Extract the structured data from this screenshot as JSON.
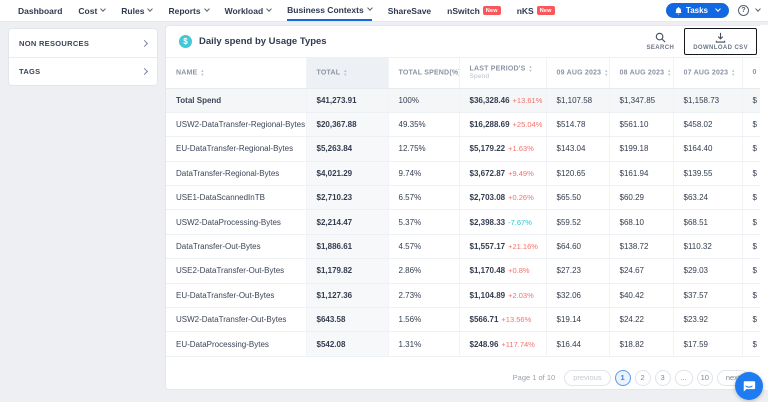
{
  "nav": {
    "items": [
      {
        "label": "Dashboard",
        "caret": false,
        "active": false
      },
      {
        "label": "Cost",
        "caret": true,
        "active": false
      },
      {
        "label": "Rules",
        "caret": true,
        "active": false
      },
      {
        "label": "Reports",
        "caret": true,
        "active": false
      },
      {
        "label": "Workload",
        "caret": true,
        "active": false
      },
      {
        "label": "Business Contexts",
        "caret": true,
        "active": true
      },
      {
        "label": "ShareSave",
        "caret": false,
        "active": false
      },
      {
        "label": "nSwitch",
        "caret": false,
        "active": false,
        "badge": "New"
      },
      {
        "label": "nKS",
        "caret": false,
        "active": false,
        "badge": "New"
      }
    ],
    "tasks_label": "Tasks"
  },
  "sidebar": {
    "items": [
      {
        "label": "NON RESOURCES"
      },
      {
        "label": "TAGS"
      }
    ]
  },
  "panel": {
    "title": "Daily spend by Usage Types",
    "toolbar": {
      "search_label": "SEARCH",
      "download_label": "DOWNLOAD CSV"
    }
  },
  "table": {
    "columns": [
      {
        "label": "NAME",
        "sortable": true,
        "highlighted": false
      },
      {
        "label": "TOTAL",
        "sortable": true,
        "highlighted": true
      },
      {
        "label": "TOTAL SPEND(%)",
        "sortable": true,
        "highlighted": false
      },
      {
        "label": "LAST PERIOD'S",
        "sub": "Spend",
        "sortable": true,
        "highlighted": false
      },
      {
        "label": "09 AUG 2023",
        "sortable": true,
        "highlighted": false
      },
      {
        "label": "08 AUG 2023",
        "sortable": true,
        "highlighted": false
      },
      {
        "label": "07 AUG 2023",
        "sortable": true,
        "highlighted": false
      },
      {
        "label": "0",
        "sortable": false,
        "highlighted": false,
        "clipped": true
      }
    ],
    "rows": [
      {
        "name": "Total Spend",
        "total": "$41,273.91",
        "pct": "100%",
        "last": {
          "value": "$36,328.46",
          "change": "+13.61%",
          "dir": "up"
        },
        "days": [
          "$1,107.58",
          "$1,347.85",
          "$1,158.73"
        ],
        "cut": "$",
        "emphasis": true
      },
      {
        "name": "USW2-DataTransfer-Regional-Bytes",
        "total": "$20,367.88",
        "pct": "49.35%",
        "last": {
          "value": "$16,288.69",
          "change": "+25.04%",
          "dir": "up"
        },
        "days": [
          "$514.78",
          "$561.10",
          "$458.02"
        ],
        "cut": "$",
        "emphasis": false
      },
      {
        "name": "EU-DataTransfer-Regional-Bytes",
        "total": "$5,263.84",
        "pct": "12.75%",
        "last": {
          "value": "$5,179.22",
          "change": "+1.63%",
          "dir": "up"
        },
        "days": [
          "$143.04",
          "$199.18",
          "$164.40"
        ],
        "cut": "$",
        "emphasis": false
      },
      {
        "name": "DataTransfer-Regional-Bytes",
        "total": "$4,021.29",
        "pct": "9.74%",
        "last": {
          "value": "$3,672.87",
          "change": "+9.49%",
          "dir": "up"
        },
        "days": [
          "$120.65",
          "$161.94",
          "$139.55"
        ],
        "cut": "$",
        "emphasis": false
      },
      {
        "name": "USE1-DataScannedInTB",
        "total": "$2,710.23",
        "pct": "6.57%",
        "last": {
          "value": "$2,703.08",
          "change": "+0.26%",
          "dir": "up"
        },
        "days": [
          "$65.50",
          "$60.29",
          "$63.24"
        ],
        "cut": "$",
        "emphasis": false
      },
      {
        "name": "USW2-DataProcessing-Bytes",
        "total": "$2,214.47",
        "pct": "5.37%",
        "last": {
          "value": "$2,398.33",
          "change": "-7.67%",
          "dir": "down"
        },
        "days": [
          "$59.52",
          "$68.10",
          "$68.51"
        ],
        "cut": "$",
        "emphasis": false
      },
      {
        "name": "DataTransfer-Out-Bytes",
        "total": "$1,886.61",
        "pct": "4.57%",
        "last": {
          "value": "$1,557.17",
          "change": "+21.16%",
          "dir": "up"
        },
        "days": [
          "$64.60",
          "$138.72",
          "$110.32"
        ],
        "cut": "$",
        "emphasis": false
      },
      {
        "name": "USE2-DataTransfer-Out-Bytes",
        "total": "$1,179.82",
        "pct": "2.86%",
        "last": {
          "value": "$1,170.48",
          "change": "+0.8%",
          "dir": "up"
        },
        "days": [
          "$27.23",
          "$24.67",
          "$29.03"
        ],
        "cut": "$",
        "emphasis": false
      },
      {
        "name": "EU-DataTransfer-Out-Bytes",
        "total": "$1,127.36",
        "pct": "2.73%",
        "last": {
          "value": "$1,104.89",
          "change": "+2.03%",
          "dir": "up"
        },
        "days": [
          "$32.06",
          "$40.42",
          "$37.57"
        ],
        "cut": "$",
        "emphasis": false
      },
      {
        "name": "USW2-DataTransfer-Out-Bytes",
        "total": "$643.58",
        "pct": "1.56%",
        "last": {
          "value": "$566.71",
          "change": "+13.56%",
          "dir": "up"
        },
        "days": [
          "$19.14",
          "$24.22",
          "$23.92"
        ],
        "cut": "$",
        "emphasis": false
      },
      {
        "name": "EU-DataProcessing-Bytes",
        "total": "$542.08",
        "pct": "1.31%",
        "last": {
          "value": "$248.96",
          "change": "+117.74%",
          "dir": "up"
        },
        "days": [
          "$16.44",
          "$18.82",
          "$17.59"
        ],
        "cut": "$",
        "emphasis": false
      }
    ]
  },
  "pagination": {
    "summary": "Page 1 of 10",
    "items": [
      {
        "label": "previous",
        "kind": "prev",
        "active": false
      },
      {
        "label": "1",
        "kind": "page",
        "active": true
      },
      {
        "label": "2",
        "kind": "page",
        "active": false
      },
      {
        "label": "3",
        "kind": "page",
        "active": false
      },
      {
        "label": "...",
        "kind": "ellipsis",
        "active": false
      },
      {
        "label": "10",
        "kind": "page",
        "active": false
      },
      {
        "label": "next",
        "kind": "next",
        "active": false
      }
    ]
  },
  "colors": {
    "accent": "#1268e0",
    "positive_change": "#f4716c",
    "negative_change": "#2fc4ca",
    "title_icon": "#47c6d3",
    "new_badge": "#f9575c"
  }
}
